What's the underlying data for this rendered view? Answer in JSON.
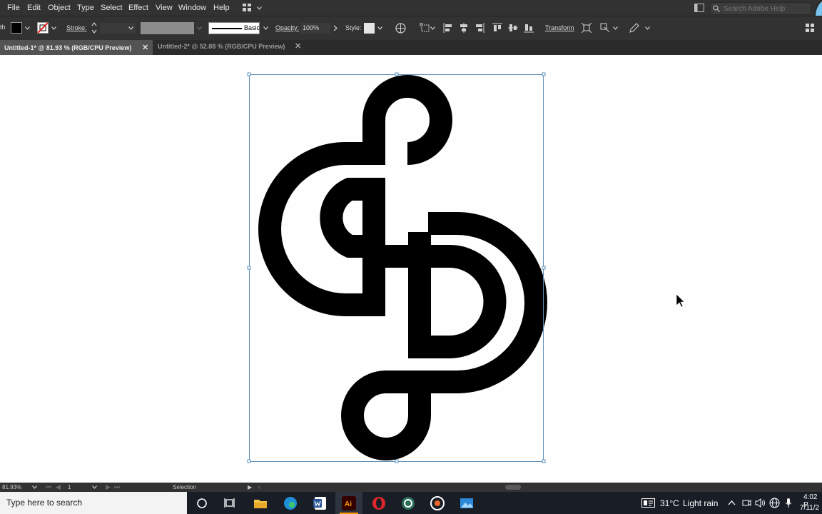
{
  "menubar": {
    "items": [
      "File",
      "Edit",
      "Object",
      "Type",
      "Select",
      "Effect",
      "View",
      "Window",
      "Help"
    ],
    "search_placeholder": "Search Adobe Help"
  },
  "controlbar": {
    "path_label": "th",
    "stroke_label": "Stroke:",
    "brush_label": "Basic",
    "opacity_label": "Opacity:",
    "opacity_value": "100%",
    "style_label": "Style:",
    "transform_label": "Transform"
  },
  "tabs": [
    {
      "title": "Untitled-1* @ 81.93 % (RGB/CPU Preview)",
      "active": true
    },
    {
      "title": "Untitled-2* @ 52.88 % (RGB/CPU Preview)",
      "active": false
    }
  ],
  "statusbar": {
    "zoom": "81.93%",
    "artboard": "1",
    "tool": "Selection"
  },
  "taskbar": {
    "search_placeholder": "Type here to search",
    "weather_temp": "31°C",
    "weather_text": "Light rain",
    "time": "4:02 P",
    "date": "7/11/2"
  },
  "colors": {
    "ui_dark": "#323232",
    "ui_mid": "#535353",
    "canvas": "#fefefe",
    "selection": "#5e8fb8",
    "artwork": "#000000",
    "taskbar": "#191e26"
  }
}
